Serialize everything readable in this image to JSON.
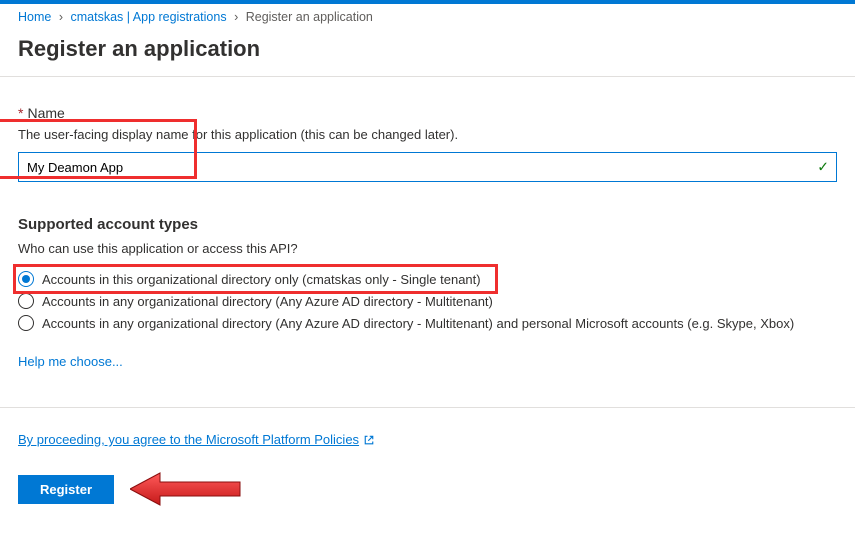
{
  "breadcrumb": {
    "home": "Home",
    "app_reg": "cmatskas | App registrations",
    "current": "Register an application"
  },
  "page_title": "Register an application",
  "name_section": {
    "label": "Name",
    "help": "The user-facing display name for this application (this can be changed later).",
    "value": "My Deamon App"
  },
  "account_types": {
    "heading": "Supported account types",
    "help": "Who can use this application or access this API?",
    "options": [
      "Accounts in this organizational directory only (cmatskas only - Single tenant)",
      "Accounts in any organizational directory (Any Azure AD directory - Multitenant)",
      "Accounts in any organizational directory (Any Azure AD directory - Multitenant) and personal Microsoft accounts (e.g. Skype, Xbox)"
    ],
    "help_link": "Help me choose..."
  },
  "footer": {
    "policies": "By proceeding, you agree to the Microsoft Platform Policies",
    "register": "Register"
  }
}
